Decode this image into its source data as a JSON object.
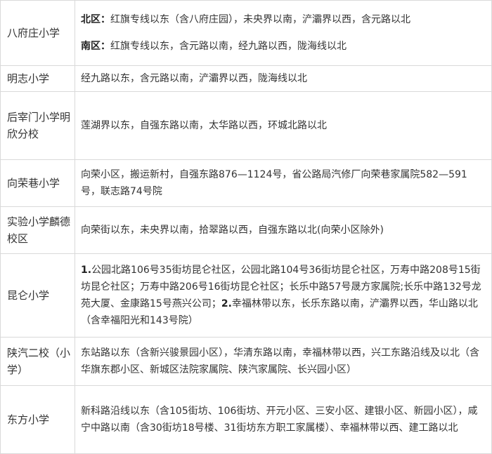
{
  "rows": [
    {
      "school": "八府庄小学",
      "north_label": "北区：",
      "north_text": "红旗专线以东（含八府庄园），未央界以南，浐灞界以西，含元路以北",
      "south_label": "南区：",
      "south_text": "红旗专线以东，含元路以南，经九路以西，陇海线以北"
    },
    {
      "school": "明志小学",
      "text": "经九路以东，含元路以南，浐灞界以西，陇海线以北"
    },
    {
      "school": "后宰门小学明欣分校",
      "text": "莲湖界以东，自强东路以南，太华路以西，环城北路以北"
    },
    {
      "school": "向荣巷小学",
      "text": "向荣小区，搬运新村，自强东路876—1124号，省公路局汽修厂向荣巷家属院582—591号，联志路74号院"
    },
    {
      "school": "实验小学麟德校区",
      "text": "向荣街以东，未央界以南，拾翠路以西，自强东路以北(向荣小区除外)"
    },
    {
      "school": "昆仑小学",
      "num1": "1.",
      "text1": "公园北路106号35街坊昆仑社区，公园北路104号36街坊昆仑社区，万寿中路208号15街坊昆仑社区；万寿中路206号16街坊昆仑社区；长乐中路57号晟方家属院;长乐中路132号龙苑大厦、金康路15号燕兴公司；",
      "num2": "2.",
      "text2": "幸福林带以东，长乐东路以南，浐灞界以西，华山路以北（含幸福阳光和143号院）"
    },
    {
      "school": "陕汽二校（小学）",
      "text": "东站路以东（含新兴骏景园小区），华清东路以南，幸福林带以西，兴工东路沿线及以北（含华旗东郡小区、新城区法院家属院、陕汽家属院、长兴园小区）"
    },
    {
      "school": "东方小学",
      "text": "新科路沿线以东（含105街坊、106街坊、开元小区、三安小区、建银小区、新园小区），咸宁中路以南（含30街坊18号楼、31街坊东方职工家属楼）、幸福林带以西、建工路以北"
    }
  ]
}
